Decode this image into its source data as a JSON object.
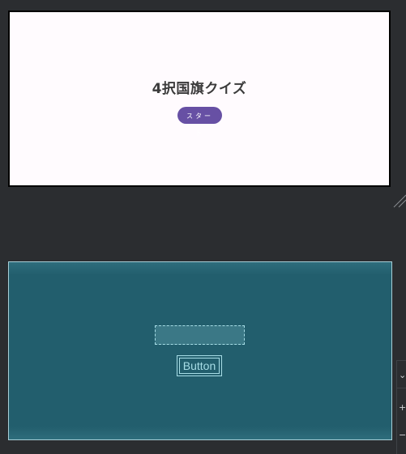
{
  "design": {
    "title": "4択国旗クイズ",
    "start_label": "スタート",
    "background_color": "#fffbfe",
    "button_color": "#6750a4"
  },
  "blueprint": {
    "button_label": "Button",
    "background_color": "#225e6d",
    "outline_color": "#a7dde6"
  },
  "toolbar": {
    "items": [
      "⌄",
      "+",
      "−"
    ]
  }
}
